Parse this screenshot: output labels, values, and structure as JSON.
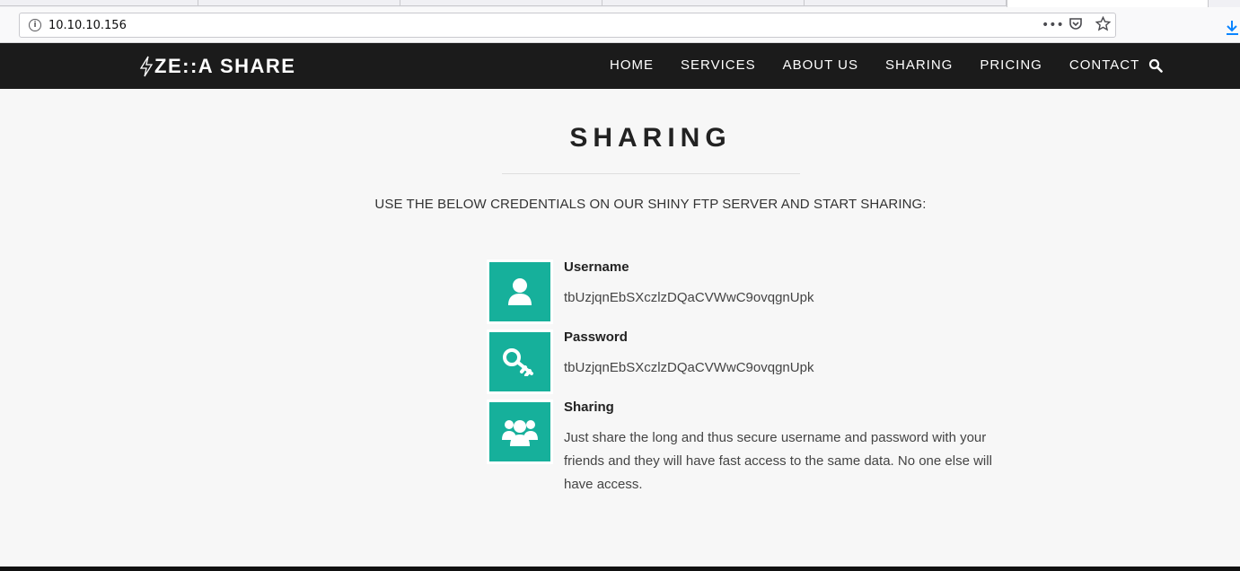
{
  "browser": {
    "url": "10.10.10.156",
    "page_actions_icon": "ellipsis-icon",
    "pocket_icon": "pocket-icon",
    "bookmark_icon": "star-icon",
    "download_icon": "download-arrow-icon"
  },
  "header": {
    "logo_text": "ZE::A SHARE",
    "nav": [
      "HOME",
      "SERVICES",
      "ABOUT US",
      "SHARING",
      "PRICING",
      "CONTACT"
    ],
    "search_icon": "search-icon"
  },
  "section": {
    "title": "SHARING",
    "intro": "USE THE BELOW CREDENTIALS ON OUR SHINY FTP SERVER AND START SHARING:"
  },
  "features": [
    {
      "icon": "user-icon",
      "title": "Username",
      "text": "tbUzjqnEbSXczlzDQaCVWwC9ovqgnUpk"
    },
    {
      "icon": "key-icon",
      "title": "Password",
      "text": "tbUzjqnEbSXczlzDQaCVWwC9ovqgnUpk"
    },
    {
      "icon": "users-group-icon",
      "title": "Sharing",
      "text": "Just share the long and thus secure username and password with your friends and they will have fast access to the same data. No one else will have access."
    }
  ],
  "colors": {
    "accent": "#16b09b",
    "header_bg": "#1b1b1b",
    "page_bg": "#f7f7f7"
  }
}
